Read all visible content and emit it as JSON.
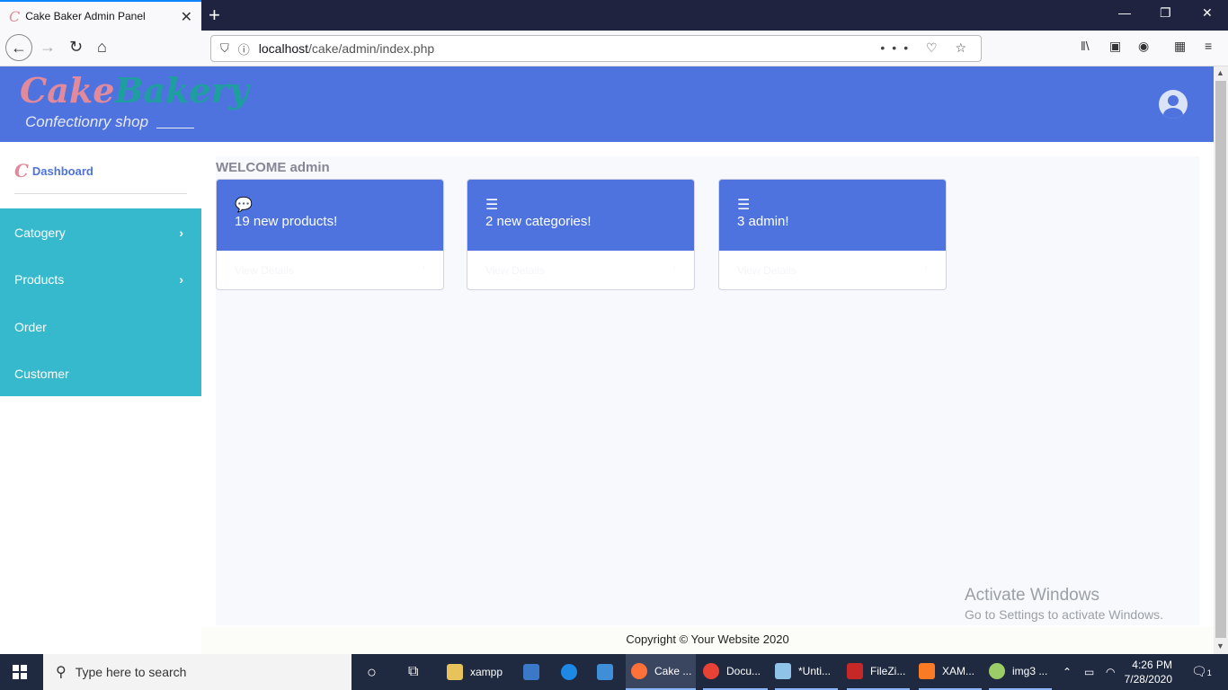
{
  "browser": {
    "tab_title": "Cake Baker Admin Panel",
    "tab_close": "✕",
    "new_tab": "+",
    "url_host": "localhost",
    "url_path": "/cake/admin/index.php",
    "url_actions": "••• ♡ ☆",
    "win_min": "—",
    "win_restore": "❐",
    "win_close": "✕"
  },
  "header": {
    "brand_part1": "Cake",
    "brand_part2": "Bakery",
    "tagline": "Confectionry shop"
  },
  "sidebar": {
    "dashboard_label": "Dashboard",
    "items": [
      {
        "label": "Catogery",
        "has_chevron": true
      },
      {
        "label": "Products",
        "has_chevron": true
      },
      {
        "label": "Order",
        "has_chevron": false
      },
      {
        "label": "Customer",
        "has_chevron": false
      }
    ]
  },
  "main": {
    "welcome": "WELCOME admin",
    "cards": [
      {
        "icon": "comments-icon",
        "text": "19 new products!",
        "footer": "View Details"
      },
      {
        "icon": "list-icon",
        "text": "2 new categories!",
        "footer": "View Details"
      },
      {
        "icon": "list-icon",
        "text": "3 admin!",
        "footer": "View Details"
      }
    ]
  },
  "footer": {
    "copyright": "Copyright © Your Website 2020"
  },
  "watermark": {
    "line1": "Activate Windows",
    "line2": "Go to Settings to activate Windows."
  },
  "taskbar": {
    "search_placeholder": "Type here to search",
    "apps": [
      {
        "label": "xampp"
      },
      {
        "label": "Cake ..."
      },
      {
        "label": "Docu..."
      },
      {
        "label": "*Unti..."
      },
      {
        "label": "FileZi..."
      },
      {
        "label": "XAM..."
      },
      {
        "label": "img3 ..."
      }
    ],
    "time": "4:26 PM",
    "date": "7/28/2020",
    "notification_count": "1"
  },
  "colors": {
    "primary": "#4e73df",
    "sidebar": "#36b9cc",
    "brand_pink": "#e08a9b",
    "brand_teal": "#1f9ea0"
  }
}
